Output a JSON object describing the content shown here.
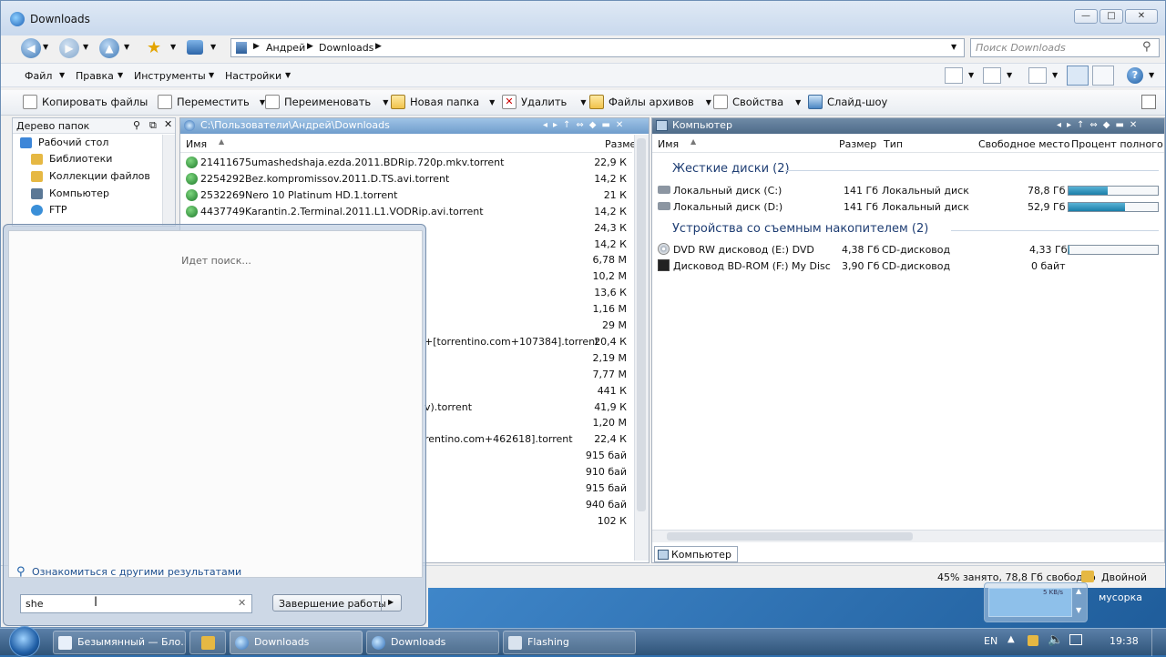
{
  "window": {
    "title": "Downloads"
  },
  "address": {
    "parts": [
      "Андрей",
      "Downloads"
    ]
  },
  "search": {
    "placeholder": "Поиск Downloads"
  },
  "menu": {
    "items": [
      "Файл",
      "Правка",
      "Инструменты",
      "Настройки"
    ]
  },
  "toolbar": {
    "items": [
      "Копировать файлы",
      "Переместить",
      "Переименовать",
      "Новая папка",
      "Удалить",
      "Файлы архивов",
      "Свойства",
      "Слайд-шоу"
    ]
  },
  "tree": {
    "title": "Дерево папок",
    "items": [
      "Рабочий стол",
      "Библиотеки",
      "Коллекции файлов",
      "Компьютер",
      "FTP"
    ]
  },
  "left_pane": {
    "path": "C:\\Пользователи\\Андрей\\Downloads",
    "col_name": "Имя",
    "col_size": "Разме",
    "files": [
      {
        "name": "21411675umashedshaja.ezda.2011.BDRip.720p.mkv.torrent",
        "size": "22,9 К"
      },
      {
        "name": "2254292Bez.kompromissov.2011.D.TS.avi.torrent",
        "size": "14,2 К"
      },
      {
        "name": "2532269Nero 10 Platinum HD.1.torrent",
        "size": "21 К"
      },
      {
        "name": "4437749Karantin.2.Terminal.2011.L1.VODRip.avi.torrent",
        "size": "14,2 К"
      },
      {
        "name": "",
        "size": "24,3 К"
      },
      {
        "name": "",
        "size": "14,2 К"
      },
      {
        "name": "",
        "size": "6,78 М"
      },
      {
        "name": "",
        "size": "10,2 М"
      },
      {
        "name": "",
        "size": "13,6 К"
      },
      {
        "name": "",
        "size": "1,16 М"
      },
      {
        "name": "",
        "size": "29 М"
      },
      {
        "name": "+[torrentino.com+107384].torrent",
        "size": "20,4 К"
      },
      {
        "name": "",
        "size": "2,19 М"
      },
      {
        "name": "",
        "size": "7,77 М"
      },
      {
        "name": "",
        "size": "441 К"
      },
      {
        "name": "v).torrent",
        "size": "41,9 К"
      },
      {
        "name": "",
        "size": "1,20 М"
      },
      {
        "name": "rentino.com+462618].torrent",
        "size": "22,4 К"
      },
      {
        "name": "",
        "size": "915 бай"
      },
      {
        "name": "",
        "size": "910 бай"
      },
      {
        "name": "",
        "size": "915 бай"
      },
      {
        "name": "",
        "size": "940 бай"
      },
      {
        "name": "",
        "size": "102 К"
      }
    ]
  },
  "right_pane": {
    "title": "Компьютер",
    "cols": [
      "Имя",
      "Размер",
      "Тип",
      "Свободное место",
      "Процент полного"
    ],
    "groups": [
      {
        "title": "Жесткие диски (2)",
        "drives": [
          {
            "name": "Локальный диск (C:)",
            "size": "141 Гб",
            "type": "Локальный диск",
            "free": "78,8 Гб",
            "used": 0.44
          },
          {
            "name": "Локальный диск (D:)",
            "size": "141 Гб",
            "type": "Локальный диск",
            "free": "52,9 Гб",
            "used": 0.63
          }
        ]
      },
      {
        "title": "Устройства со съемным накопителем (2)",
        "drives": [
          {
            "name": "DVD RW дисковод (E:) DVD",
            "size": "4,38 Гб",
            "type": "CD-дисковод",
            "free": "4,33 Гб",
            "used": 0.01
          },
          {
            "name": "Дисковод BD-ROM (F:) My Disc",
            "size": "3,90 Гб",
            "type": "CD-дисковод",
            "free": "0 байт",
            "used": null
          }
        ]
      }
    ],
    "tab": "Компьютер"
  },
  "status": {
    "text": "45% занято, 78,8 Гб свободно",
    "mode": "Двойной"
  },
  "start_menu": {
    "searching": "Идет поиск...",
    "more_results": "Ознакомиться с другими результатами",
    "query": "she",
    "shutdown": "Завершение работы"
  },
  "taskbar": {
    "tasks": [
      "Безымянный — Бло...",
      "Downloads",
      "Downloads",
      "Flashing"
    ],
    "lang": "EN",
    "time": "19:38",
    "tray_label": "мусорка",
    "net_speed": "5 KB/s"
  }
}
